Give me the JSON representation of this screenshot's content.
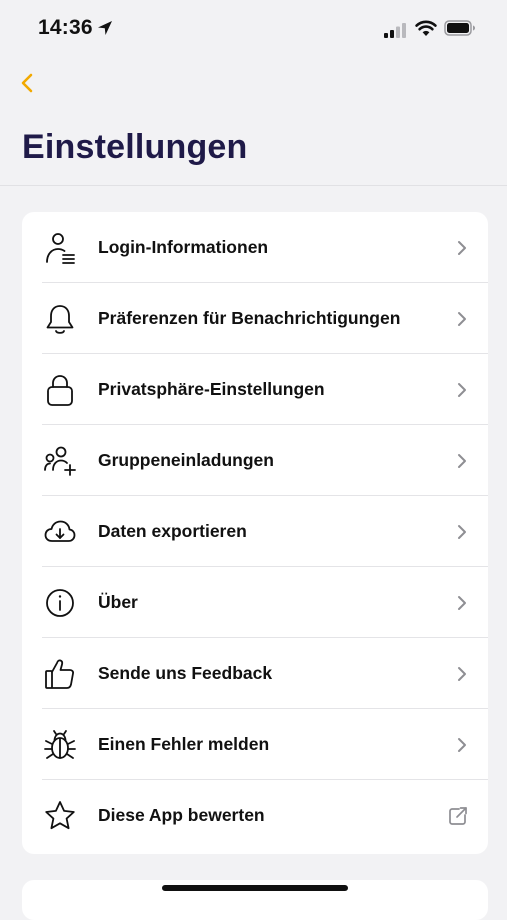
{
  "status_bar": {
    "time": "14:36",
    "icons": [
      "location-arrow-icon",
      "cellular-signal-icon",
      "wifi-icon",
      "battery-icon"
    ]
  },
  "navigation": {
    "back_icon": "chevron-left-icon"
  },
  "page": {
    "title": "Einstellungen"
  },
  "colors": {
    "accent": "#f2a900",
    "title": "#1f1a48",
    "background": "#f2f2f4",
    "card": "#ffffff",
    "divider": "#e4e4e7"
  },
  "settings": {
    "items": [
      {
        "label": "Login-Informationen",
        "icon": "user-details-icon",
        "trailing": "chevron-right-icon"
      },
      {
        "label": "Präferenzen für Benachrichtigungen",
        "icon": "bell-icon",
        "trailing": "chevron-right-icon"
      },
      {
        "label": "Privatsphäre-Einstellungen",
        "icon": "lock-icon",
        "trailing": "chevron-right-icon"
      },
      {
        "label": "Gruppeneinladungen",
        "icon": "group-add-icon",
        "trailing": "chevron-right-icon"
      },
      {
        "label": "Daten exportieren",
        "icon": "cloud-download-icon",
        "trailing": "chevron-right-icon"
      },
      {
        "label": "Über",
        "icon": "info-icon",
        "trailing": "chevron-right-icon"
      },
      {
        "label": "Sende uns Feedback",
        "icon": "thumbs-up-icon",
        "trailing": "chevron-right-icon"
      },
      {
        "label": "Einen Fehler melden",
        "icon": "bug-icon",
        "trailing": "chevron-right-icon"
      },
      {
        "label": "Diese App bewerten",
        "icon": "star-icon",
        "trailing": "external-link-icon"
      }
    ]
  }
}
